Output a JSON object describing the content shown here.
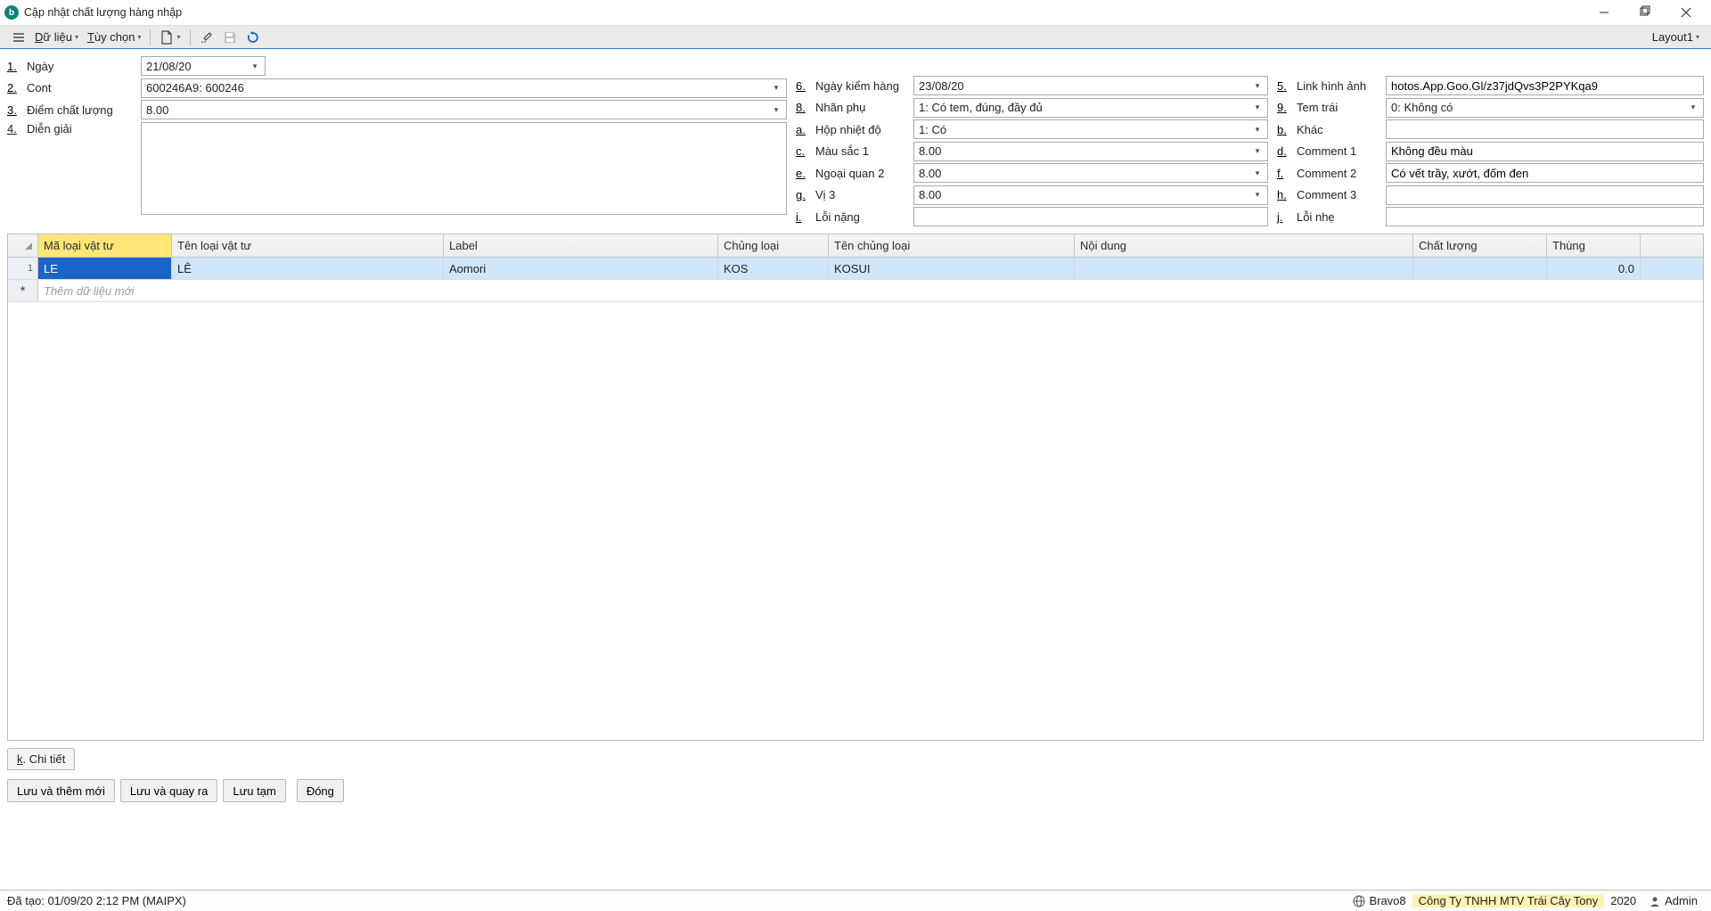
{
  "window": {
    "title": "Cập nhật chất lượng hàng nhập"
  },
  "toolbar": {
    "menu_data": "Dữ liệu",
    "menu_options": "Tùy chọn",
    "layout": "Layout1"
  },
  "form": {
    "l1": {
      "mnemonic": "1.",
      "label": "Ngày",
      "value": "21/08/20",
      "type": "date"
    },
    "l2": {
      "mnemonic": "2.",
      "label": "Cont",
      "value": "600246A9: 600246",
      "type": "dropdown"
    },
    "l3": {
      "mnemonic": "3.",
      "label": "Điểm chất lượng",
      "value": "8.00",
      "type": "dropdown"
    },
    "l4": {
      "mnemonic": "4.",
      "label": "Diễn giải",
      "value": ""
    },
    "m6": {
      "mnemonic": "6.",
      "label": "Ngày kiểm hàng",
      "value": "23/08/20",
      "type": "date"
    },
    "m8": {
      "mnemonic": "8.",
      "label": "Nhãn phụ",
      "value": "1: Có tem, đúng, đầy đủ",
      "type": "dropdown"
    },
    "ma": {
      "mnemonic": "a.",
      "label": "Hộp nhiệt độ",
      "value": "1: Có",
      "type": "dropdown"
    },
    "mc": {
      "mnemonic": "c.",
      "label": "Màu sắc 1",
      "value": "8.00",
      "type": "dropdown"
    },
    "me": {
      "mnemonic": "e.",
      "label": "Ngoại quan 2",
      "value": "8.00",
      "type": "dropdown"
    },
    "mg": {
      "mnemonic": "g.",
      "label": "Vị 3",
      "value": "8.00",
      "type": "dropdown"
    },
    "mi": {
      "mnemonic": "i.",
      "label": "Lỗi nặng",
      "value": ""
    },
    "r5": {
      "mnemonic": "5.",
      "label": "Link hình ảnh",
      "value": "hotos.App.Goo.Gl/z37jdQvs3P2PYKqa9"
    },
    "r9": {
      "mnemonic": "9.",
      "label": "Tem trái",
      "value": "0: Không có",
      "type": "dropdown"
    },
    "rb": {
      "mnemonic": "b.",
      "label": "Khác",
      "value": ""
    },
    "rd": {
      "mnemonic": "d.",
      "label": "Comment 1",
      "value": "Không đều màu"
    },
    "rf": {
      "mnemonic": "f.",
      "label": "Comment 2",
      "value": "Có vết trầy, xướt, đốm đen"
    },
    "rh": {
      "mnemonic": "h.",
      "label": "Comment 3",
      "value": ""
    },
    "rj": {
      "mnemonic": "j.",
      "label": "Lỗi nhẹ",
      "value": ""
    }
  },
  "grid": {
    "columns": [
      "Mã loại vật tư",
      "Tên loại vật tư",
      "Label",
      "Chủng loại",
      "Tên chủng loại",
      "Nội dung",
      "Chất lượng",
      "Thùng"
    ],
    "row1": {
      "ma": "LE",
      "ten": "LÊ",
      "label": "Aomori",
      "chung": "KOS",
      "tenchung": "KOSUI",
      "noidung": "",
      "chatluong": "",
      "thung": "0.0"
    },
    "new_row_placeholder": "Thêm dữ liệu mới"
  },
  "tab": {
    "chitiet_mn": "k",
    "chitiet_lbl": ". Chi tiết"
  },
  "buttons": {
    "save_new": "Lưu và thêm mới",
    "save_return": "Lưu và quay ra",
    "save_temp": "Lưu tạm",
    "close": "Đóng"
  },
  "status": {
    "created": "Đã tạo: 01/09/20 2:12 PM (MAIPX)",
    "app": "Bravo8",
    "company": "Công Ty TNHH MTV Trái Cây Tony",
    "year": "2020",
    "user": "Admin"
  }
}
